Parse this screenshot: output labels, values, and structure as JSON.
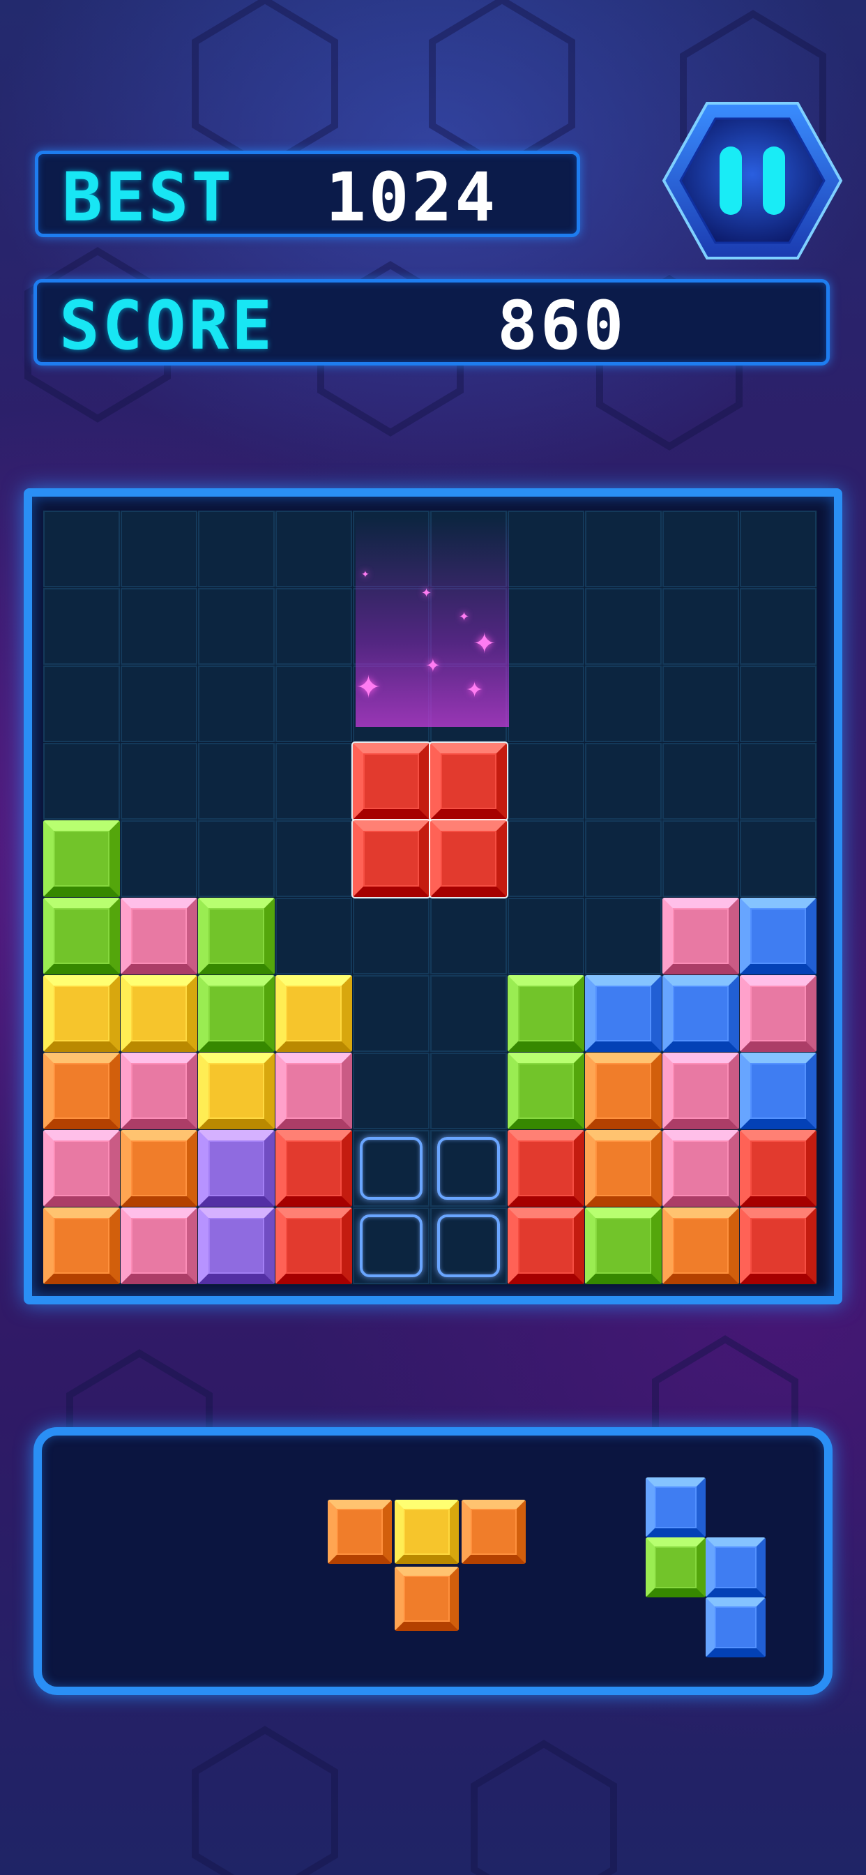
{
  "colors": {
    "red": "#e23a2e",
    "pink": "#e879a3",
    "green": "#72c42a",
    "yellow": "#f6c52c",
    "orange": "#f07d2a",
    "blue": "#3f7df2",
    "purple": "#8f6be0",
    "accent": "#18e6f4",
    "frame": "#2a8ff5"
  },
  "header": {
    "best_label": "BEST",
    "best_value": "1024",
    "score_label": "SCORE",
    "score_value": "860",
    "pause_icon": "pause-icon"
  },
  "board": {
    "cols": 10,
    "rows": 10,
    "cells": [
      "..........",
      "..........",
      "..........",
      "..........",
      "G.........",
      "GPG......PB",
      "YYGY..GBBP",
      "OPYP..GOPB",
      "POVRgg.ROPR",
      "OPVRgg.RGOR"
    ],
    "grid": [
      [
        null,
        null,
        null,
        null,
        null,
        null,
        null,
        null,
        null,
        null
      ],
      [
        null,
        null,
        null,
        null,
        null,
        null,
        null,
        null,
        null,
        null
      ],
      [
        null,
        null,
        null,
        null,
        null,
        null,
        null,
        null,
        null,
        null
      ],
      [
        null,
        null,
        null,
        null,
        null,
        null,
        null,
        null,
        null,
        null
      ],
      [
        "green",
        null,
        null,
        null,
        null,
        null,
        null,
        null,
        null,
        null
      ],
      [
        "green",
        "pink",
        "green",
        null,
        null,
        null,
        null,
        null,
        "pink",
        "blue"
      ],
      [
        "yellow",
        "yellow",
        "green",
        "yellow",
        null,
        null,
        "green",
        "blue",
        "blue",
        "pink"
      ],
      [
        "orange",
        "pink",
        "yellow",
        "pink",
        null,
        null,
        "green",
        "orange",
        "pink",
        "blue"
      ],
      [
        "pink",
        "orange",
        "purple",
        "red",
        null,
        null,
        "red",
        "orange",
        "pink",
        "red"
      ],
      [
        "orange",
        "pink",
        "purple",
        "red",
        null,
        null,
        "red",
        "green",
        "orange",
        "red"
      ]
    ],
    "falling_piece": {
      "color": "red",
      "cells": [
        [
          2,
          0
        ],
        [
          3,
          0
        ],
        [
          2,
          1
        ],
        [
          3,
          1
        ]
      ],
      "origin_col": 4,
      "origin_row": 3
    },
    "ghost_cells": [
      [
        4,
        8
      ],
      [
        5,
        8
      ],
      [
        4,
        9
      ],
      [
        5,
        9
      ]
    ]
  },
  "tray": {
    "pieces": [
      {
        "name": "t-piece",
        "cells": [
          {
            "c": 0,
            "r": 0,
            "color": "orange"
          },
          {
            "c": 1,
            "r": 0,
            "color": "yellow"
          },
          {
            "c": 2,
            "r": 0,
            "color": "orange"
          },
          {
            "c": 1,
            "r": 1,
            "color": "orange"
          }
        ]
      },
      {
        "name": "s-piece",
        "cells": [
          {
            "c": 0,
            "r": 0,
            "color": "blue"
          },
          {
            "c": 0,
            "r": 1,
            "color": "green"
          },
          {
            "c": 1,
            "r": 1,
            "color": "blue"
          },
          {
            "c": 1,
            "r": 2,
            "color": "blue"
          }
        ]
      }
    ]
  }
}
